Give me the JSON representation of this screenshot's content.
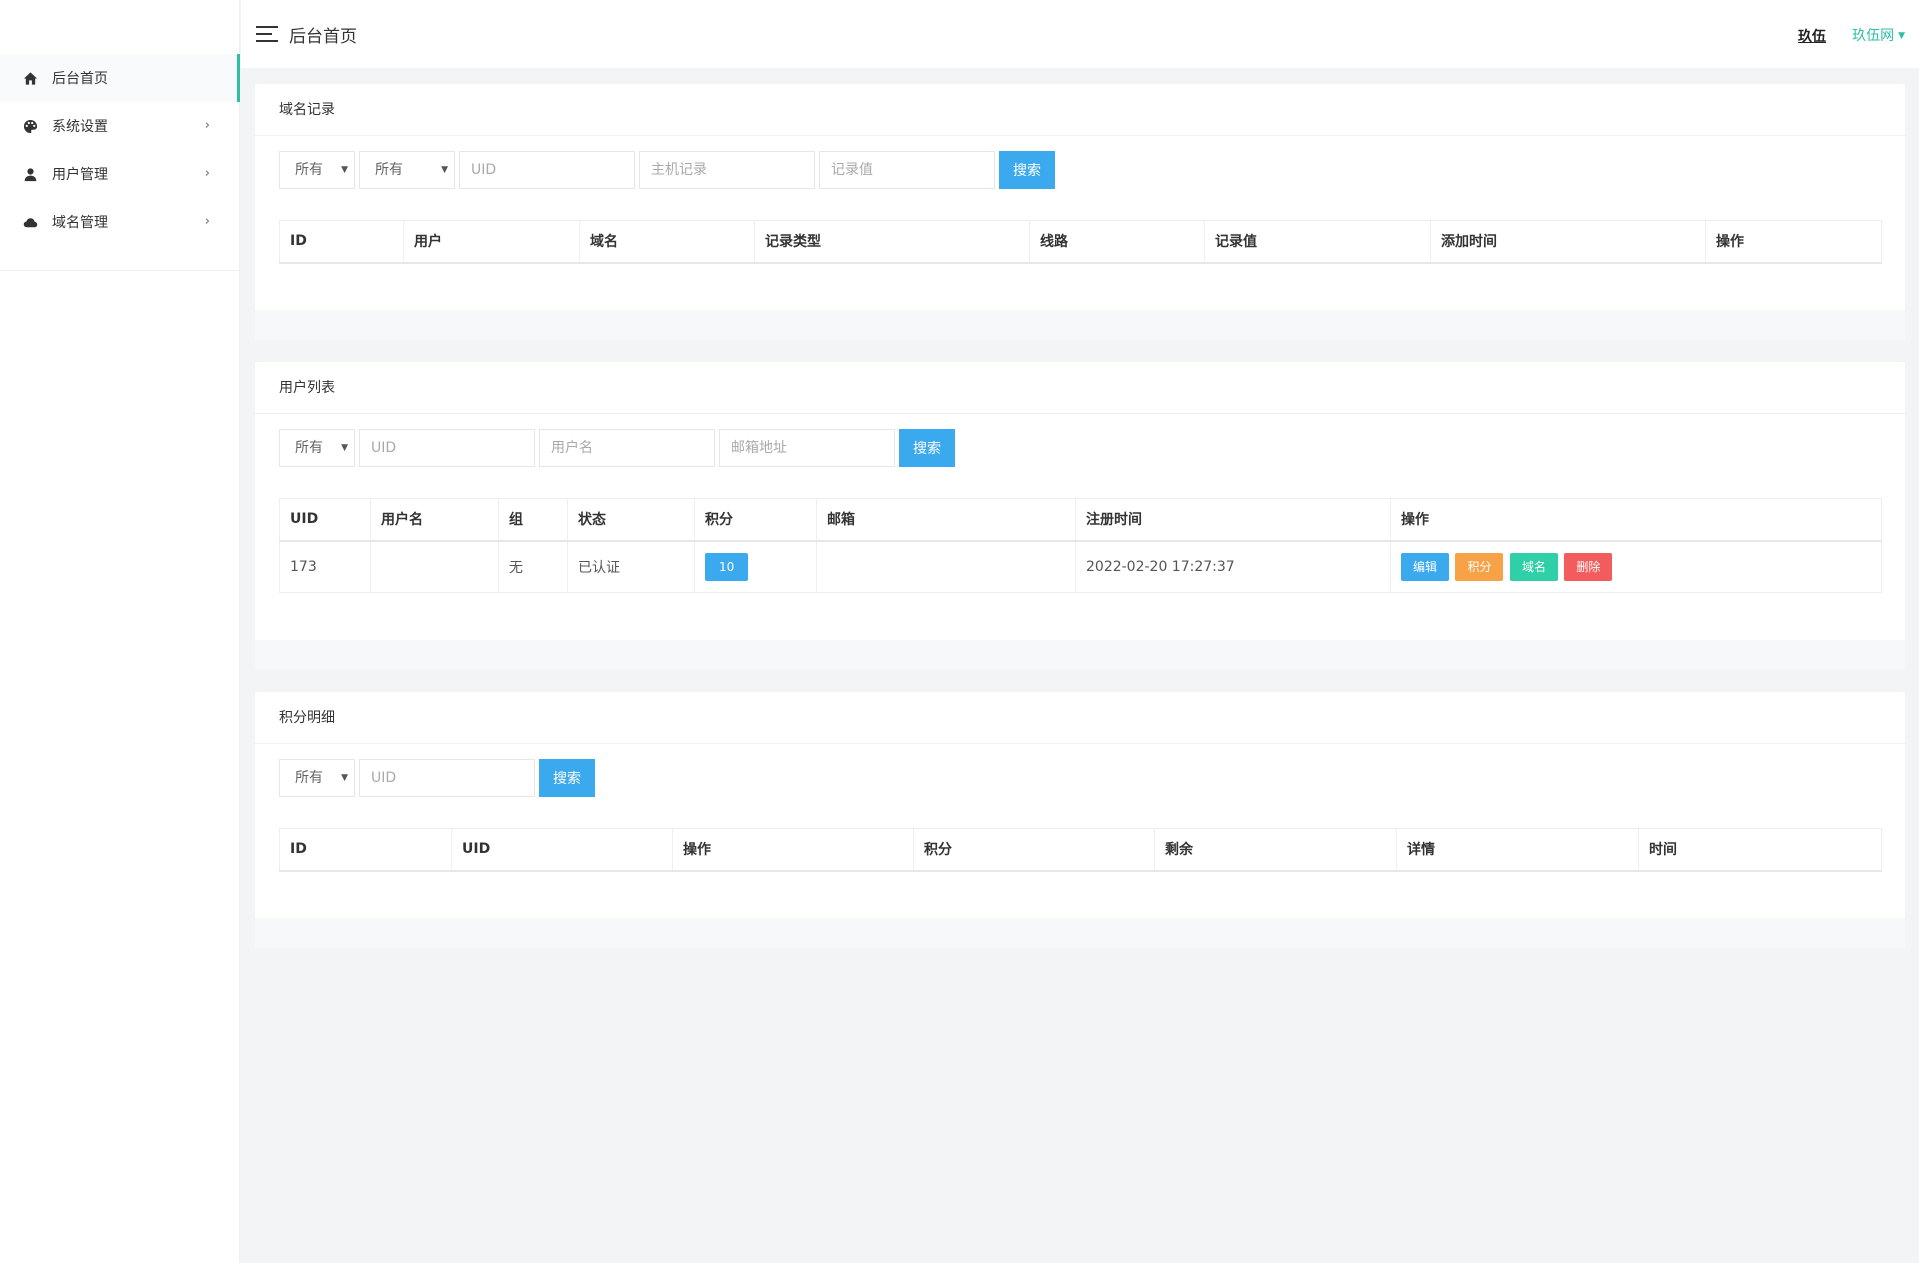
{
  "sidebar": {
    "items": [
      {
        "label": "后台首页",
        "icon": "home-icon"
      },
      {
        "label": "系统设置",
        "icon": "palette-icon"
      },
      {
        "label": "用户管理",
        "icon": "user-icon"
      },
      {
        "label": "域名管理",
        "icon": "cloud-icon"
      }
    ],
    "arrow": "›"
  },
  "topbar": {
    "title": "后台首页",
    "link1": "玖伍",
    "link2": "玖伍网"
  },
  "domain_panel": {
    "title": "域名记录",
    "filter": {
      "select1": "所有",
      "select2": "所有",
      "uid_placeholder": "UID",
      "host_placeholder": "主机记录",
      "value_placeholder": "记录值",
      "search_label": "搜索"
    },
    "columns": [
      "ID",
      "用户",
      "域名",
      "记录类型",
      "线路",
      "记录值",
      "添加时间",
      "操作"
    ]
  },
  "user_panel": {
    "title": "用户列表",
    "filter": {
      "select1": "所有",
      "uid_placeholder": "UID",
      "username_placeholder": "用户名",
      "email_placeholder": "邮箱地址",
      "search_label": "搜索"
    },
    "columns": [
      "UID",
      "用户名",
      "组",
      "状态",
      "积分",
      "邮箱",
      "注册时间",
      "操作"
    ],
    "rows": [
      {
        "uid": "173",
        "username": "",
        "group": "无",
        "status": "已认证",
        "score": "10",
        "email": "",
        "reg_time": "2022-02-20 17:27:37",
        "actions": {
          "edit": "编辑",
          "score": "积分",
          "domain": "域名",
          "delete": "删除"
        }
      }
    ]
  },
  "score_panel": {
    "title": "积分明细",
    "filter": {
      "select1": "所有",
      "uid_placeholder": "UID",
      "search_label": "搜索"
    },
    "columns": [
      "ID",
      "UID",
      "操作",
      "积分",
      "剩余",
      "详情",
      "时间"
    ]
  },
  "colors": {
    "accent": "#2bbfa4",
    "primary_button": "#3ba9ee",
    "warning_button": "#f7a247",
    "success_button": "#2fcfa7",
    "danger_button": "#f25c5c"
  }
}
